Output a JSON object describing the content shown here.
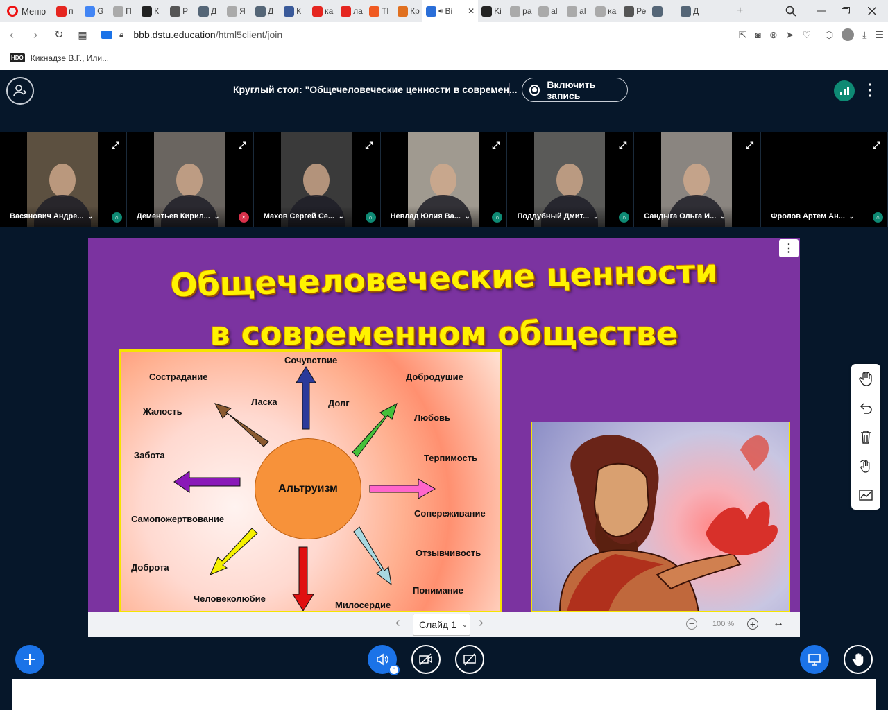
{
  "browser": {
    "menu_label": "Меню",
    "tabs": [
      {
        "label": "п",
        "icon": "yandex-icon",
        "color": "#e52620"
      },
      {
        "label": "G",
        "icon": "translate-icon",
        "color": "#4285f4"
      },
      {
        "label": "П",
        "icon": "loading-icon",
        "color": "#aaaaaa"
      },
      {
        "label": "К",
        "icon": "hdo-icon",
        "color": "#222222"
      },
      {
        "label": "Р",
        "icon": "globe-icon",
        "color": "#555555"
      },
      {
        "label": "Д",
        "icon": "gear-icon",
        "color": "#556677"
      },
      {
        "label": "Я",
        "icon": "loading-icon",
        "color": "#aaaaaa"
      },
      {
        "label": "Д",
        "icon": "gear-icon",
        "color": "#556677"
      },
      {
        "label": "К",
        "icon": "mail-icon",
        "color": "#3a5a9a"
      },
      {
        "label": "ка",
        "icon": "yandex-icon",
        "color": "#e52620"
      },
      {
        "label": "ла",
        "icon": "yandex-icon",
        "color": "#e52620"
      },
      {
        "label": "Тl",
        "icon": "tilda-icon",
        "color": "#f05a22"
      },
      {
        "label": "Кр",
        "icon": "km-icon",
        "color": "#e07020"
      },
      {
        "label": "Bi",
        "icon": "bbb-icon",
        "color": "#2a6ed8",
        "active": true
      },
      {
        "label": "Ki",
        "icon": "hdo-icon",
        "color": "#222222"
      },
      {
        "label": "ра",
        "icon": "loading-icon",
        "color": "#aaaaaa"
      },
      {
        "label": "al",
        "icon": "loading-icon",
        "color": "#aaaaaa"
      },
      {
        "label": "al",
        "icon": "loading-icon",
        "color": "#aaaaaa"
      },
      {
        "label": "ка",
        "icon": "loading-icon",
        "color": "#aaaaaa"
      },
      {
        "label": "Ре",
        "icon": "globe-icon",
        "color": "#555555"
      },
      {
        "label": "",
        "icon": "gear-icon",
        "color": "#556677"
      },
      {
        "label": "Д",
        "icon": "gear-icon",
        "color": "#556677"
      }
    ],
    "new_tab": "+",
    "url_host": "bbb.dstu.education",
    "url_path": "/html5client/join",
    "bookmark": "Кикнадзе В.Г., Или..."
  },
  "meeting": {
    "title": "Круглый стол: \"Общечеловеческие ценности в современ...",
    "record_label": "Включить запись"
  },
  "participants": [
    {
      "name": "Васянович Андре...",
      "status": "headset",
      "bg": "#5c5040"
    },
    {
      "name": "Дементьев Кирил...",
      "status": "muted",
      "bg": "#6a6560"
    },
    {
      "name": "Махов Сергей Се...",
      "status": "headset",
      "bg": "#3a3a3a"
    },
    {
      "name": "Невлад Юлия Ва...",
      "status": "headset",
      "bg": "#a09a90"
    },
    {
      "name": "Поддубный Дмит...",
      "status": "headset",
      "bg": "#5a5a58"
    },
    {
      "name": "Сандыга Ольга И...",
      "status": "none",
      "bg": "#8a8580"
    },
    {
      "name": "Фролов Артем Ан...",
      "status": "headset",
      "bg": "#000000"
    }
  ],
  "slide": {
    "title_line1": "Общечеловеческие ценности",
    "title_line2": "в современном обществе",
    "center": "Альтруизм",
    "words": {
      "sochuvstvie": "Сочувствие",
      "sostradanie": "Сострадание",
      "dobrodushie": "Добродушие",
      "laska": "Ласка",
      "dolg": "Долг",
      "zhalost": "Жалость",
      "lyubov": "Любовь",
      "zabota": "Забота",
      "terpimost": "Терпимость",
      "samopozhertvovanie": "Самопожертвование",
      "soperezhivanie": "Сопереживание",
      "otzyvchivost": "Отзывчивость",
      "dobrota": "Доброта",
      "ponimanie": "Понимание",
      "chelovekolyubie": "Человеколюбие",
      "miloserdie": "Милосердие"
    },
    "arrow_colors": {
      "up": "#2b3a9a",
      "upleft": "#8b5a30",
      "upright": "#44c03a",
      "left": "#8a18b8",
      "right": "#ff66cc",
      "downleft": "#f5f000",
      "down": "#e01010",
      "downright": "#a8d8e0"
    }
  },
  "presentation_bar": {
    "slide_label": "Слайд 1",
    "zoom": "100 %"
  },
  "colors": {
    "app_bg": "#06172a",
    "slide_bg": "#7b33a0",
    "accent_blue": "#1b73e8",
    "connection_green": "#0e8a74"
  }
}
